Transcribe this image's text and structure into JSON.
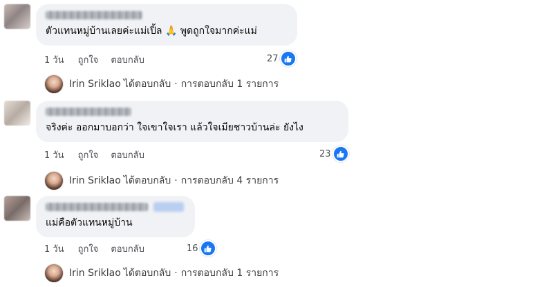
{
  "comments": [
    {
      "text_part1": "ตัวแทนหมู่บ้านเลยค่ะแม่เปิ้ล",
      "emoji": "🙏",
      "text_part2": "พูดถูกใจมากค่ะแม่",
      "time": "1 วัน",
      "like_label": "ถูกใจ",
      "reply_label": "ตอบกลับ",
      "like_count": "27",
      "reply_summary": {
        "author": "Irin Sriklao",
        "verb": "ได้ตอบกลับ",
        "dot": "·",
        "count_text": "การตอบกลับ 1 รายการ"
      }
    },
    {
      "text": "จริงค่ะ ออกมาบอกว่า ใจเขาใจเรา แล้วใจเมียชาวบ้านล่ะ ยังไง",
      "time": "1 วัน",
      "like_label": "ถูกใจ",
      "reply_label": "ตอบกลับ",
      "like_count": "23",
      "reply_summary": {
        "author": "Irin Sriklao",
        "verb": "ได้ตอบกลับ",
        "dot": "·",
        "count_text": "การตอบกลับ 4 รายการ"
      }
    },
    {
      "text": "แม่คือตัวแทนหมู่บ้าน",
      "time": "1 วัน",
      "like_label": "ถูกใจ",
      "reply_label": "ตอบกลับ",
      "like_count": "16",
      "reply_summary": {
        "author": "Irin Sriklao",
        "verb": "ได้ตอบกลับ",
        "dot": "·",
        "count_text": "การตอบกลับ 1 รายการ"
      }
    }
  ],
  "icons": {
    "like": "thumbs-up-icon",
    "accent": "#1877f2"
  }
}
